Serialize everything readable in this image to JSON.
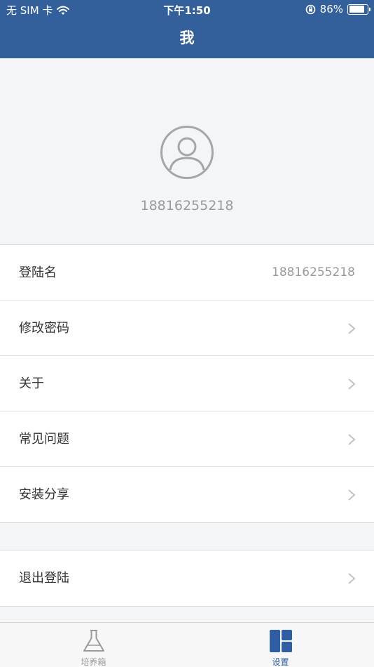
{
  "statusbar": {
    "carrier": "无 SIM 卡",
    "time": "下午1:50",
    "battery": "86%",
    "battery_level": 0.86
  },
  "navbar": {
    "title": "我"
  },
  "profile": {
    "phone": "18816255218"
  },
  "menu": [
    {
      "label": "登陆名",
      "value": "18816255218"
    },
    {
      "label": "修改密码"
    },
    {
      "label": "关于"
    },
    {
      "label": "常见问题"
    },
    {
      "label": "安装分享"
    }
  ],
  "logout": {
    "label": "退出登陆"
  },
  "tabs": [
    {
      "label": "培养箱",
      "icon": "flask-icon"
    },
    {
      "label": "设置",
      "icon": "settings-grid-icon"
    }
  ],
  "colors": {
    "primary": "#33609a",
    "tab_active": "#2f5ea3",
    "tab_inactive": "#9a9a9e"
  }
}
